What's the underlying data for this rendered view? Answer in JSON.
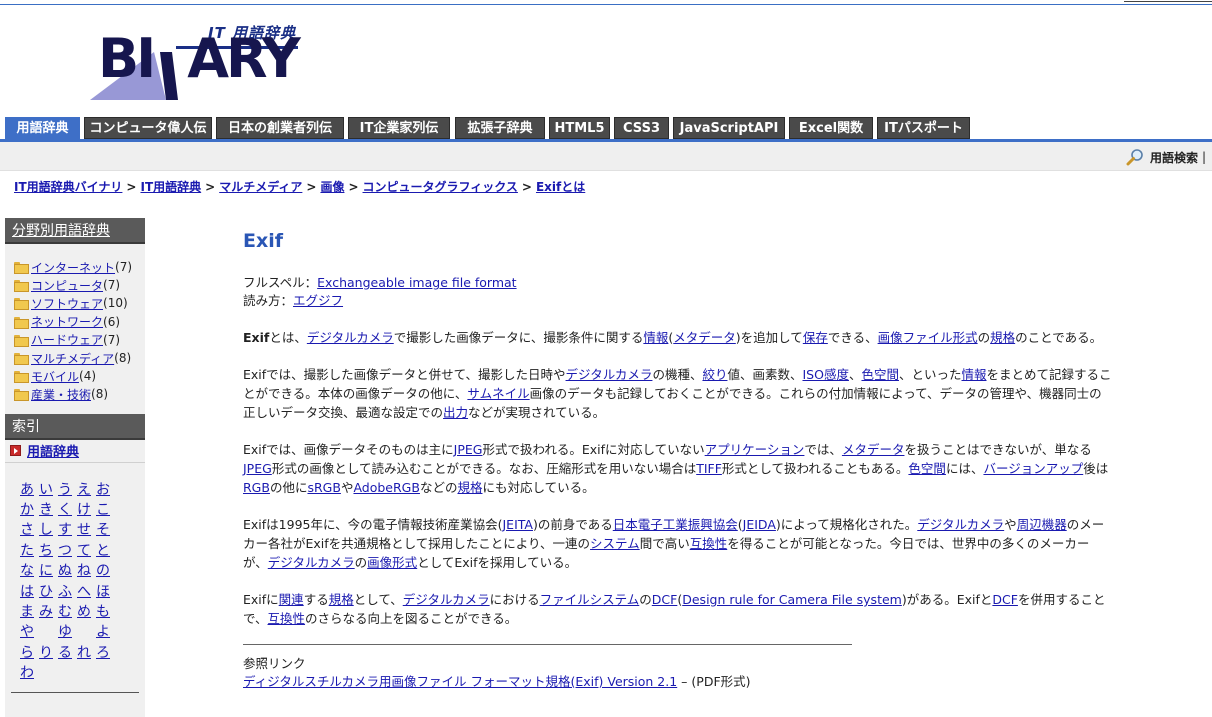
{
  "logo": {
    "subtitle": "IT 用語辞典",
    "text_left": "BI",
    "text_right": "ARY"
  },
  "tabs": [
    {
      "label": "用語辞典",
      "active": true
    },
    {
      "label": "コンピュータ偉人伝"
    },
    {
      "label": "日本の創業者列伝"
    },
    {
      "label": "IT企業家列伝"
    },
    {
      "label": "拡張子辞典"
    },
    {
      "label": "HTML5"
    },
    {
      "label": "CSS3"
    },
    {
      "label": "JavaScriptAPI"
    },
    {
      "label": "Excel関数"
    },
    {
      "label": "ITパスポート"
    }
  ],
  "search": {
    "label": "用語検索",
    "divider": "|"
  },
  "breadcrumb": {
    "items": [
      "IT用語辞典バイナリ",
      "IT用語辞典",
      "マルチメディア",
      "画像",
      "コンピュータグラフィックス",
      "Exifとは"
    ],
    "separator": ">"
  },
  "sidebar": {
    "category_header": "分野別用語辞典",
    "categories": [
      {
        "label": "インターネット",
        "count": "(7)"
      },
      {
        "label": "コンピュータ",
        "count": "(7)"
      },
      {
        "label": "ソフトウェア",
        "count": "(10)"
      },
      {
        "label": "ネットワーク",
        "count": "(6)"
      },
      {
        "label": "ハードウェア",
        "count": "(7)"
      },
      {
        "label": "マルチメディア",
        "count": "(8)"
      },
      {
        "label": "モバイル",
        "count": "(4)"
      },
      {
        "label": "産業・技術",
        "count": "(8)"
      }
    ],
    "index_header": "索引",
    "index_sub": "用語辞典",
    "kana_rows": [
      [
        "あ",
        "い",
        "う",
        "え",
        "お"
      ],
      [
        "か",
        "き",
        "く",
        "け",
        "こ"
      ],
      [
        "さ",
        "し",
        "す",
        "せ",
        "そ"
      ],
      [
        "た",
        "ち",
        "つ",
        "て",
        "と"
      ],
      [
        "な",
        "に",
        "ぬ",
        "ね",
        "の"
      ],
      [
        "は",
        "ひ",
        "ふ",
        "へ",
        "ほ"
      ],
      [
        "ま",
        "み",
        "む",
        "め",
        "も"
      ],
      [
        "や",
        "",
        "ゆ",
        "",
        "よ"
      ],
      [
        "ら",
        "り",
        "る",
        "れ",
        "ろ"
      ],
      [
        "わ"
      ]
    ]
  },
  "main": {
    "title": "Exif",
    "fullspell_label": "フルスペル：",
    "fullspell_value": "Exchangeable image file format",
    "reading_label": "読み方：",
    "reading_value": "エグジフ",
    "paragraphs": [
      [
        {
          "b": "Exif"
        },
        {
          "t": "とは、"
        },
        {
          "a": "デジタルカメラ"
        },
        {
          "t": "で撮影した画像データに、撮影条件に関する"
        },
        {
          "a": "情報"
        },
        {
          "t": "("
        },
        {
          "a": "メタデータ"
        },
        {
          "t": ")を追加して"
        },
        {
          "a": "保存"
        },
        {
          "t": "できる、"
        },
        {
          "a": "画像ファイル形式"
        },
        {
          "t": "の"
        },
        {
          "a": "規格"
        },
        {
          "t": "のことである。"
        }
      ],
      [
        {
          "t": "Exifでは、撮影した画像データと併せて、撮影した日時や"
        },
        {
          "a": "デジタルカメラ"
        },
        {
          "t": "の機種、"
        },
        {
          "a": "絞り"
        },
        {
          "t": "値、画素数、"
        },
        {
          "a": "ISO感度"
        },
        {
          "t": "、"
        },
        {
          "a": "色空間"
        },
        {
          "t": "、といった"
        },
        {
          "a": "情報"
        },
        {
          "t": "をまとめて記録することができる。本体の画像データの他に、"
        },
        {
          "a": "サムネイル"
        },
        {
          "t": "画像のデータも記録しておくことができる。これらの付加情報によって、データの管理や、機器同士の正しいデータ交換、最適な設定での"
        },
        {
          "a": "出力"
        },
        {
          "t": "などが実現されている。"
        }
      ],
      [
        {
          "t": "Exifでは、画像データそのものは主に"
        },
        {
          "a": "JPEG"
        },
        {
          "t": "形式で扱われる。Exifに対応していない"
        },
        {
          "a": "アプリケーション"
        },
        {
          "t": "では、"
        },
        {
          "a": "メタデータ"
        },
        {
          "t": "を扱うことはできないが、単なる"
        },
        {
          "a": "JPEG"
        },
        {
          "t": "形式の画像として読み込むことができる。なお、圧縮形式を用いない場合は"
        },
        {
          "a": "TIFF"
        },
        {
          "t": "形式として扱われることもある。"
        },
        {
          "a": "色空間"
        },
        {
          "t": "には、"
        },
        {
          "a": "バージョンアップ"
        },
        {
          "t": "後は"
        },
        {
          "a": "RGB"
        },
        {
          "t": "の他に"
        },
        {
          "a": "sRGB"
        },
        {
          "t": "や"
        },
        {
          "a": "AdobeRGB"
        },
        {
          "t": "などの"
        },
        {
          "a": "規格"
        },
        {
          "t": "にも対応している。"
        }
      ],
      [
        {
          "t": "Exifは1995年に、今の電子情報技術産業協会("
        },
        {
          "a": "JEITA"
        },
        {
          "t": ")の前身である"
        },
        {
          "a": "日本電子工業振興協会"
        },
        {
          "t": "("
        },
        {
          "a": "JEIDA"
        },
        {
          "t": ")によって規格化された。"
        },
        {
          "a": "デジタルカメラ"
        },
        {
          "t": "や"
        },
        {
          "a": "周辺機器"
        },
        {
          "t": "のメーカー各社がExifを共通規格として採用したことにより、一連の"
        },
        {
          "a": "システム"
        },
        {
          "t": "間で高い"
        },
        {
          "a": "互換性"
        },
        {
          "t": "を得ることが可能となった。今日では、世界中の多くのメーカーが、"
        },
        {
          "a": "デジタルカメラ"
        },
        {
          "t": "の"
        },
        {
          "a": "画像形式"
        },
        {
          "t": "としてExifを採用している。"
        }
      ],
      [
        {
          "t": "Exifに"
        },
        {
          "a": "関連"
        },
        {
          "t": "する"
        },
        {
          "a": "規格"
        },
        {
          "t": "として、"
        },
        {
          "a": "デジタルカメラ"
        },
        {
          "t": "における"
        },
        {
          "a": "ファイルシステム"
        },
        {
          "t": "の"
        },
        {
          "a": "DCF"
        },
        {
          "t": "("
        },
        {
          "a": "Design rule for Camera File system"
        },
        {
          "t": ")がある。Exifと"
        },
        {
          "a": "DCF"
        },
        {
          "t": "を併用することで、"
        },
        {
          "a": "互換性"
        },
        {
          "t": "のさらなる向上を図ることができる。"
        }
      ]
    ],
    "ref_header": "参照リンク",
    "ref_link": "ディジタルスチルカメラ用画像ファイル フォーマット規格(Exif) Version 2.1",
    "ref_suffix": " – (PDF形式)"
  }
}
